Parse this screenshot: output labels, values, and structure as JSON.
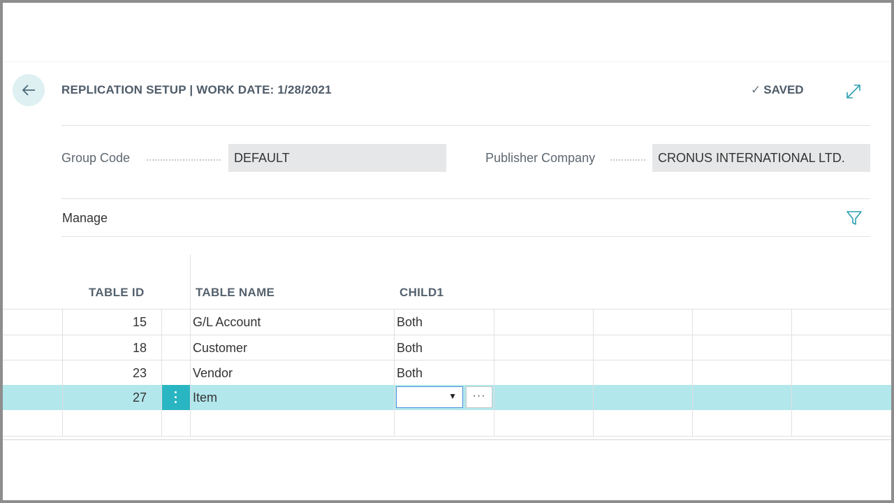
{
  "header": {
    "title": "REPLICATION SETUP | WORK DATE: 1/28/2021",
    "saved_label": "SAVED"
  },
  "fields": {
    "group_code": {
      "label": "Group Code",
      "value": "DEFAULT"
    },
    "publisher_company": {
      "label": "Publisher Company",
      "value": "CRONUS INTERNATIONAL LTD."
    }
  },
  "lines": {
    "manage_label": "Manage",
    "columns": [
      "TABLE ID",
      "TABLE NAME",
      "CHILD1"
    ],
    "rows": [
      {
        "table_id": "15",
        "table_name": "G/L Account",
        "child1": "Both"
      },
      {
        "table_id": "18",
        "table_name": "Customer",
        "child1": "Both"
      },
      {
        "table_id": "23",
        "table_name": "Vendor",
        "child1": "Both"
      },
      {
        "table_id": "27",
        "table_name": "Item",
        "child1": ""
      }
    ],
    "selected_row": 3
  },
  "colors": {
    "selected_row": "#b2e7ec",
    "row_menu": "#29b6c2",
    "accent": "#008489"
  },
  "icons": [
    "back-arrow-icon",
    "checkmark-icon",
    "expand-icon",
    "filter-icon",
    "vertical-ellipsis-icon",
    "dropdown-arrow-icon",
    "ellipsis-icon"
  ]
}
